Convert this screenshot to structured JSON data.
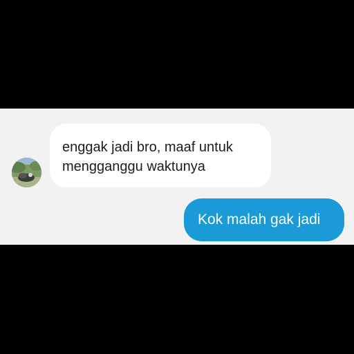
{
  "conversation": {
    "messages": [
      {
        "direction": "incoming",
        "lines": [
          "enggak jadi bro, maaf untuk",
          "mengganggu waktunya"
        ]
      },
      {
        "direction": "outgoing",
        "lines": [
          "Kok malah gak jadi"
        ]
      }
    ]
  },
  "colors": {
    "background": "#000000",
    "chat_background": "#f2f2f2",
    "incoming_bubble": "#ffffff",
    "outgoing_bubble": "#1a9ad6",
    "incoming_text": "#1c1c1c",
    "outgoing_text": "#ffffff"
  },
  "icons": {
    "avatar": "contact-avatar-photo"
  }
}
